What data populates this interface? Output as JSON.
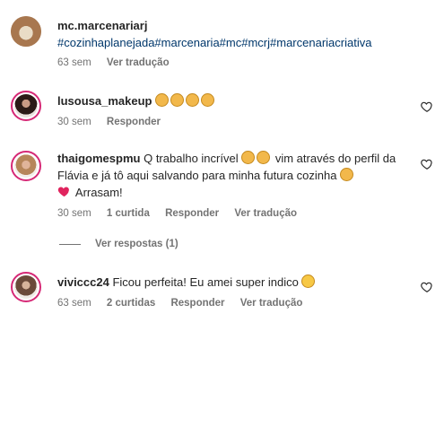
{
  "caption": {
    "username": "mc.marcenariarj",
    "hashtags": "#cozinhaplanejada#marcenaria#mc#mcrj#marcenariacriativa",
    "time": "63 sem",
    "translate": "Ver tradução"
  },
  "comments": [
    {
      "username": "lusousa_makeup",
      "text": "",
      "time": "30 sem",
      "likes": "",
      "reply": "Responder",
      "translate": ""
    },
    {
      "username": "thaigomespmu",
      "text_part1": "Q trabalho incrível",
      "text_part2": "vim através do perfil da Flávia e já tô aqui salvando para minha futura cozinha",
      "text_part3": "Arrasam!",
      "time": "30 sem",
      "likes": "1 curtida",
      "reply": "Responder",
      "translate": "Ver tradução",
      "view_replies": "Ver respostas (1)"
    },
    {
      "username": "viviccc24",
      "text": "Ficou perfeita! Eu amei super indico",
      "time": "63 sem",
      "likes": "2 curtidas",
      "reply": "Responder",
      "translate": "Ver tradução"
    }
  ],
  "icons": [
    "heart-icon",
    "clapping-hands-emoji",
    "raised-hands-emoji",
    "red-heart-emoji",
    "heart-eyes-emoji"
  ],
  "colors": {
    "link": "#00376b",
    "meta": "#737373",
    "story_ring": "#d62976"
  }
}
